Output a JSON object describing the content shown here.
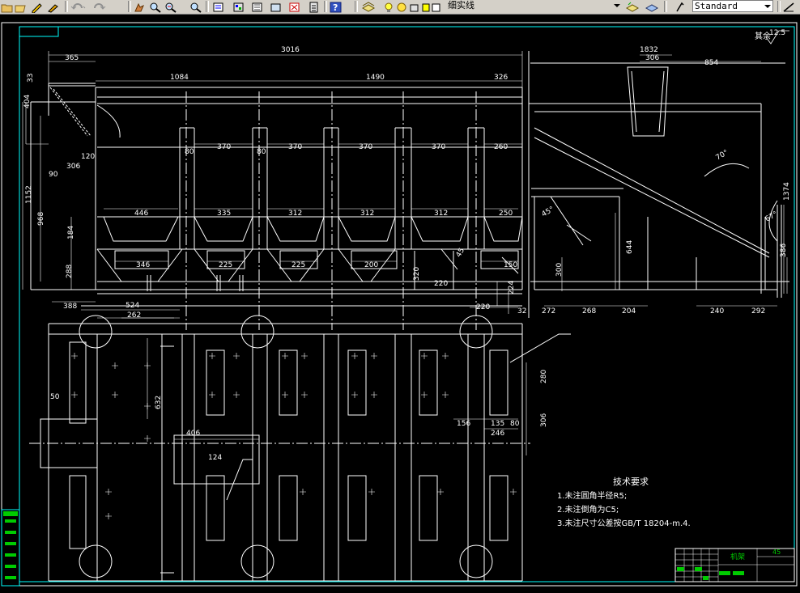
{
  "toolbar": {
    "linetype_label": "细实线",
    "textstyle_label": "Standard"
  },
  "drawing": {
    "dims_top": {
      "overall": "3016",
      "d365": "365",
      "d1084": "1084",
      "d1490": "1490",
      "d326": "326",
      "d1832": "1832",
      "d306": "306",
      "d854": "854",
      "d404": "404",
      "d33": "33",
      "d120": "120",
      "d306b": "306",
      "d90": "90",
      "d1152": "1152",
      "d968": "968",
      "d184": "184",
      "d288": "288",
      "d80a": "80",
      "d370a": "370",
      "d80b": "80",
      "d370b": "370",
      "d370c": "370",
      "d370d": "370",
      "d260": "260",
      "d446": "446",
      "d335": "335",
      "d312a": "312",
      "d312b": "312",
      "d312c": "312",
      "d250": "250",
      "d346": "346",
      "d225a": "225",
      "d225b": "225",
      "d200": "200",
      "d150": "150",
      "d320": "320",
      "d220": "220",
      "d45": "45",
      "d224": "224",
      "d124": "124",
      "d300": "300",
      "d644": "644",
      "d272": "272",
      "d268": "268",
      "d204": "204",
      "d240": "240",
      "d292": "292",
      "d70": "70°",
      "d67": "67°",
      "d45deg": "45°",
      "d1374": "1374",
      "d386": "386",
      "d388": "388",
      "d32": "32",
      "d220b": "220",
      "rest": "其余",
      "rough": "12.5"
    },
    "dims_bottom": {
      "d524": "524",
      "d262": "262",
      "d50": "50",
      "d632": "632",
      "d406": "406",
      "d124": "124",
      "d280": "280",
      "d306": "306",
      "d156": "156",
      "d135": "135",
      "d80": "80",
      "d246": "246"
    },
    "notes": {
      "title": "技术要求",
      "line1": "1.未注圆角半径R5;",
      "line2": "2.未注倒角为C5;",
      "line3": "3.未注尺寸公差按GB/T 18204-m.4."
    },
    "titleblock": {
      "name": "机架",
      "code": "45"
    }
  },
  "colors": {
    "background": "#000000",
    "line": "#ffffff",
    "frame": "#00ffff",
    "green": "#00cc00"
  }
}
